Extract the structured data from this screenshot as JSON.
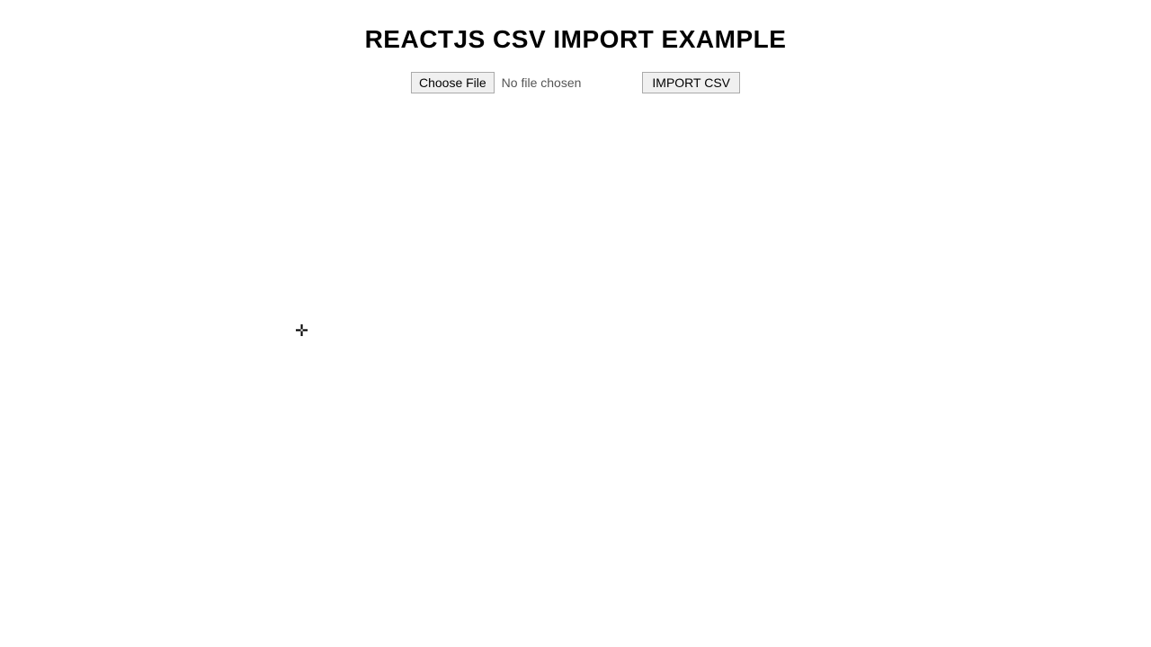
{
  "page": {
    "title": "REACTJS CSV IMPORT EXAMPLE"
  },
  "controls": {
    "choose_file_label": "Choose File",
    "no_file_label": "No file chosen",
    "import_csv_label": "IMPORT CSV"
  },
  "cursor": {
    "symbol": "✛"
  }
}
